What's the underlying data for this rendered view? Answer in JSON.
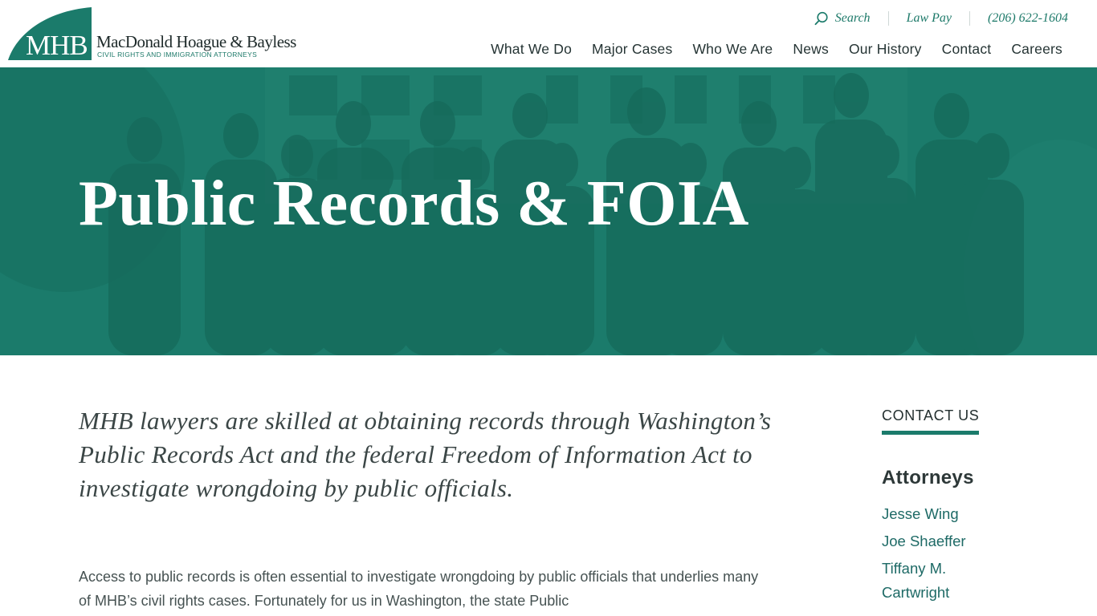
{
  "header": {
    "logo": {
      "mark_text": "MHB",
      "name": "MacDonald Hoague & Bayless",
      "tagline": "CIVIL RIGHTS AND IMMIGRATION ATTORNEYS"
    },
    "utility": {
      "search_label": "Search",
      "search_icon": "search-icon",
      "law_pay_label": "Law Pay",
      "phone": "(206) 622-1604"
    },
    "nav": [
      {
        "label": "What We Do"
      },
      {
        "label": "Major Cases"
      },
      {
        "label": "Who We Are"
      },
      {
        "label": "News"
      },
      {
        "label": "Our History"
      },
      {
        "label": "Contact"
      },
      {
        "label": "Careers"
      }
    ]
  },
  "hero": {
    "title": "Public Records & FOIA"
  },
  "main": {
    "lead": "MHB lawyers are skilled at obtaining records through Washington’s Public Records Act and the federal Freedom of Information Act to investigate wrongdoing by public officials.",
    "body": "Access to public records is often essential to investigate wrongdoing by public officials that underlies many of MHB’s civil rights cases.  Fortunately for us in Washington, the state Public"
  },
  "sidebar": {
    "contact_label": "CONTACT US",
    "attorneys_heading": "Attorneys",
    "attorneys": [
      {
        "name": "Jesse Wing"
      },
      {
        "name": "Joe Shaeffer"
      },
      {
        "name": "Tiffany M. Cartwright"
      }
    ]
  },
  "colors": {
    "brand": "#1b7b6b",
    "link": "#1e6a66",
    "text": "#3b4646"
  }
}
